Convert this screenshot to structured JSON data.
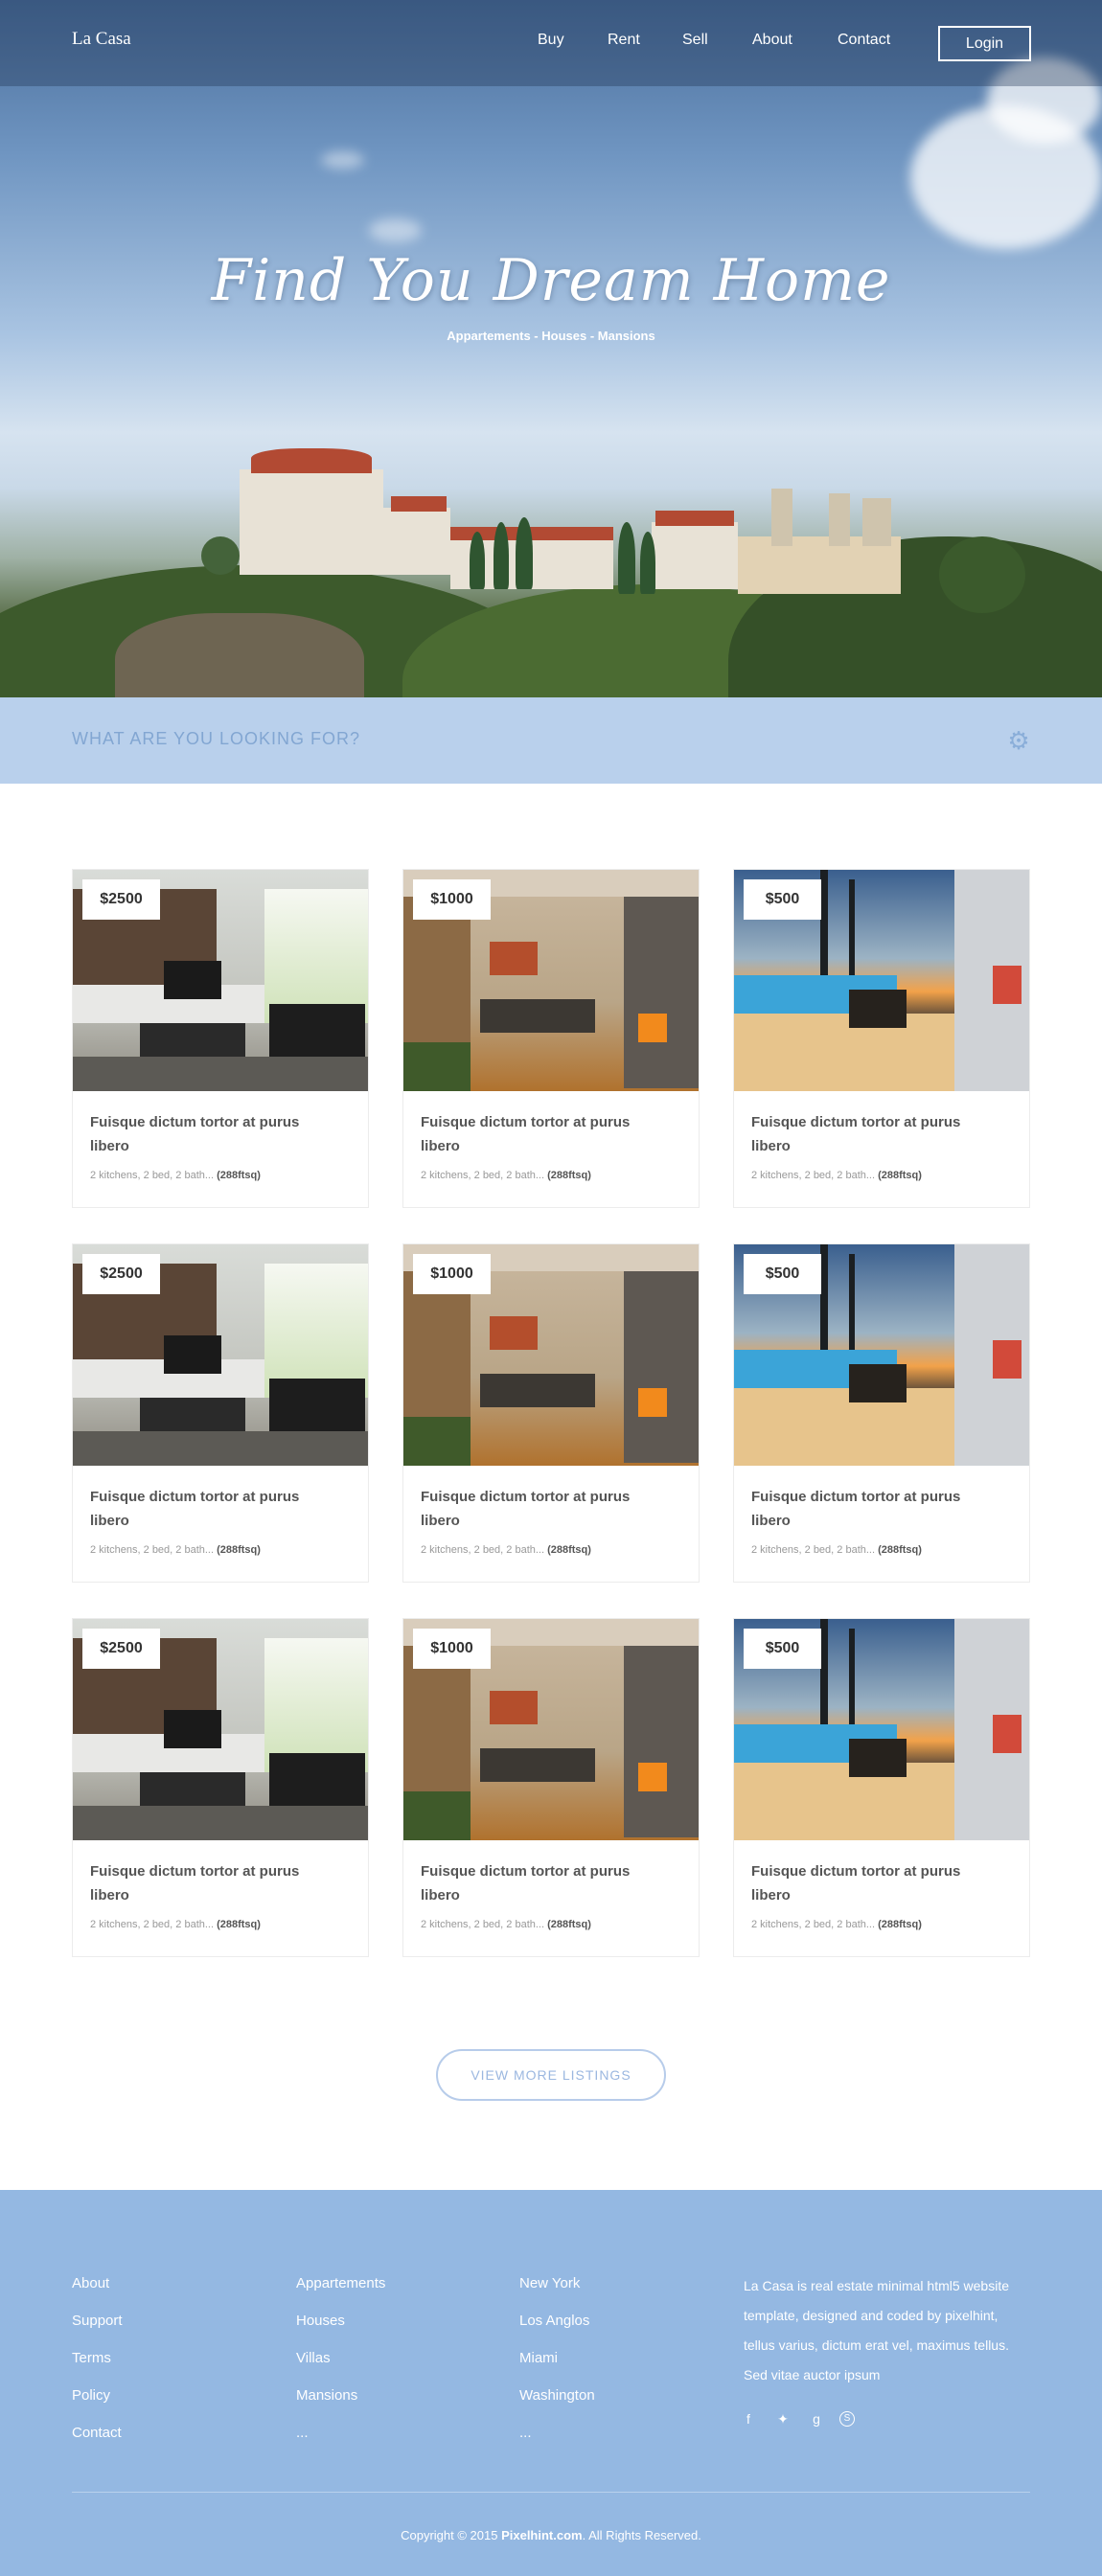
{
  "brand": "La Casa",
  "nav": {
    "items": [
      {
        "label": "Buy"
      },
      {
        "label": "Rent"
      },
      {
        "label": "Sell"
      },
      {
        "label": "About"
      },
      {
        "label": "Contact"
      }
    ],
    "login_label": "Login"
  },
  "hero": {
    "title": "Find You Dream Home",
    "subtitle": "Appartements - Houses - Mansions"
  },
  "search": {
    "prompt": "WHAT ARE YOU LOOKING FOR?",
    "icon": "gear-icon"
  },
  "listings": [
    {
      "price": "$2500",
      "title": "Fuisque dictum tortor at purus libero",
      "meta": "2 kitchens, 2 bed, 2 bath...",
      "area": "(288ftsq)",
      "image": "living-room"
    },
    {
      "price": "$1000",
      "title": "Fuisque dictum tortor at purus libero",
      "meta": "2 kitchens, 2 bed, 2 bath...",
      "area": "(288ftsq)",
      "image": "dining-room"
    },
    {
      "price": "$500",
      "title": "Fuisque dictum tortor at purus libero",
      "meta": "2 kitchens, 2 bed, 2 bath...",
      "area": "(288ftsq)",
      "image": "pool-terrace"
    },
    {
      "price": "$2500",
      "title": "Fuisque dictum tortor at purus libero",
      "meta": "2 kitchens, 2 bed, 2 bath...",
      "area": "(288ftsq)",
      "image": "living-room"
    },
    {
      "price": "$1000",
      "title": "Fuisque dictum tortor at purus libero",
      "meta": "2 kitchens, 2 bed, 2 bath...",
      "area": "(288ftsq)",
      "image": "dining-room"
    },
    {
      "price": "$500",
      "title": "Fuisque dictum tortor at purus libero",
      "meta": "2 kitchens, 2 bed, 2 bath...",
      "area": "(288ftsq)",
      "image": "pool-terrace"
    },
    {
      "price": "$2500",
      "title": "Fuisque dictum tortor at purus libero",
      "meta": "2 kitchens, 2 bed, 2 bath...",
      "area": "(288ftsq)",
      "image": "living-room"
    },
    {
      "price": "$1000",
      "title": "Fuisque dictum tortor at purus libero",
      "meta": "2 kitchens, 2 bed, 2 bath...",
      "area": "(288ftsq)",
      "image": "dining-room"
    },
    {
      "price": "$500",
      "title": "Fuisque dictum tortor at purus libero",
      "meta": "2 kitchens, 2 bed, 2 bath...",
      "area": "(288ftsq)",
      "image": "pool-terrace"
    }
  ],
  "view_more_label": "VIEW MORE LISTINGS",
  "footer": {
    "col1": [
      "About",
      "Support",
      "Terms",
      "Policy",
      "Contact"
    ],
    "col2": [
      "Appartements",
      "Houses",
      "Villas",
      "Mansions",
      "..."
    ],
    "col3": [
      "New York",
      "Los Anglos",
      "Miami",
      "Washington",
      "..."
    ],
    "about_text": "La Casa is real estate minimal html5 website template, designed and coded by pixelhint, tellus varius, dictum erat vel, maximus tellus. Sed vitae auctor ipsum",
    "social": [
      {
        "icon": "facebook-icon",
        "glyph": "f"
      },
      {
        "icon": "twitter-icon",
        "glyph": "✦"
      },
      {
        "icon": "google-icon",
        "glyph": "g"
      },
      {
        "icon": "skype-icon",
        "glyph": "S"
      }
    ],
    "copyright_prefix": "Copyright © 2015",
    "copyright_site": "Pixelhint.com",
    "copyright_suffix": ". All Rights Reserved."
  },
  "colors": {
    "accent": "#94b8e2",
    "search_bg": "#b9d0ec",
    "search_text": "#82a6d2"
  }
}
